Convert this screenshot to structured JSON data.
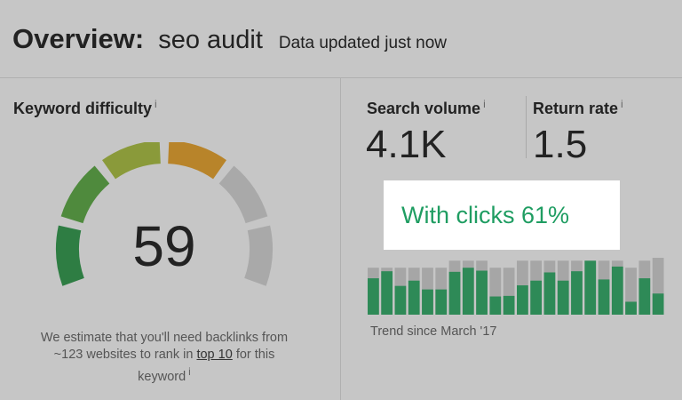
{
  "header": {
    "title": "Overview:",
    "project": "seo audit",
    "updated": "Data updated just now"
  },
  "keyword_difficulty": {
    "title": "Keyword difficulty",
    "info": "i",
    "value": "59",
    "level": 59,
    "desc_before": "We estimate that you'll need backlinks from ~123 websites to rank in ",
    "desc_link": "top 10",
    "desc_after": " for this keyword",
    "colors": {
      "filled": [
        "#2e7d43",
        "#4f8a3d",
        "#8a9a3a",
        "#b8842a"
      ],
      "empty": "#a9a9a9"
    }
  },
  "search_volume": {
    "title": "Search volume",
    "info": "i",
    "value": "4.1K"
  },
  "return_rate": {
    "title": "Return rate",
    "info": "i",
    "value": "1.5"
  },
  "clicks": {
    "text": "With clicks 61%",
    "color": "#1f9d62"
  },
  "trend": {
    "label": "Trend since March '17",
    "colors": {
      "total": "#a6a6a6",
      "clicks": "#2e8a57"
    },
    "bars": [
      {
        "total": 0.8,
        "clicks": 0.62
      },
      {
        "total": 0.8,
        "clicks": 0.74
      },
      {
        "total": 0.8,
        "clicks": 0.49
      },
      {
        "total": 0.8,
        "clicks": 0.58
      },
      {
        "total": 0.8,
        "clicks": 0.43
      },
      {
        "total": 0.8,
        "clicks": 0.43
      },
      {
        "total": 0.92,
        "clicks": 0.73
      },
      {
        "total": 0.92,
        "clicks": 0.8
      },
      {
        "total": 0.92,
        "clicks": 0.75
      },
      {
        "total": 0.8,
        "clicks": 0.31
      },
      {
        "total": 0.8,
        "clicks": 0.32
      },
      {
        "total": 0.92,
        "clicks": 0.5
      },
      {
        "total": 0.92,
        "clicks": 0.58
      },
      {
        "total": 0.92,
        "clicks": 0.72
      },
      {
        "total": 0.92,
        "clicks": 0.58
      },
      {
        "total": 0.92,
        "clicks": 0.74
      },
      {
        "total": 0.92,
        "clicks": 0.92
      },
      {
        "total": 0.92,
        "clicks": 0.6
      },
      {
        "total": 0.92,
        "clicks": 0.82
      },
      {
        "total": 0.8,
        "clicks": 0.22
      },
      {
        "total": 0.92,
        "clicks": 0.62
      },
      {
        "total": 0.97,
        "clicks": 0.36
      }
    ]
  }
}
